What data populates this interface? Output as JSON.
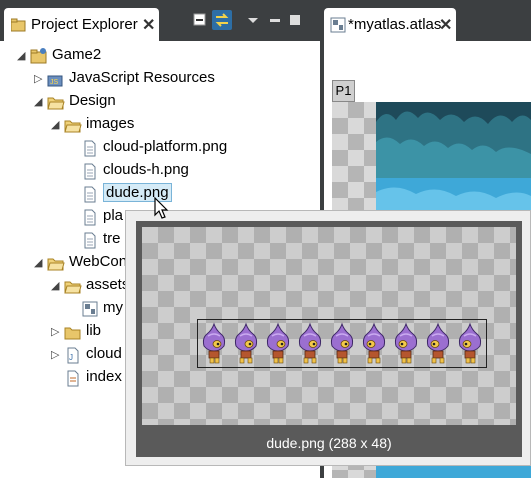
{
  "explorer": {
    "title": "Project Explorer",
    "tree": [
      {
        "label": "Game2",
        "icon": "project-folder-icon",
        "arrow": "expanded"
      },
      {
        "label": "JavaScript Resources",
        "icon": "js-resources-icon",
        "arrow": "collapsed"
      },
      {
        "label": "Design",
        "icon": "folder-open-icon",
        "arrow": "expanded"
      },
      {
        "label": "images",
        "icon": "folder-open-icon",
        "arrow": "expanded"
      },
      {
        "label": "cloud-platform.png",
        "icon": "file-icon",
        "arrow": ""
      },
      {
        "label": "clouds-h.png",
        "icon": "file-icon",
        "arrow": ""
      },
      {
        "label": "dude.png",
        "icon": "file-icon",
        "arrow": "",
        "selected": true
      },
      {
        "label": "pla",
        "icon": "file-icon",
        "arrow": ""
      },
      {
        "label": "tre",
        "icon": "file-icon",
        "arrow": ""
      },
      {
        "label": "WebCon",
        "icon": "folder-open-icon",
        "arrow": "expanded"
      },
      {
        "label": "assets",
        "icon": "folder-open-icon",
        "arrow": "expanded"
      },
      {
        "label": "my",
        "icon": "atlas-file-icon",
        "arrow": ""
      },
      {
        "label": "lib",
        "icon": "folder-closed-icon",
        "arrow": "collapsed"
      },
      {
        "label": "cloud",
        "icon": "js-file-icon",
        "arrow": "collapsed"
      },
      {
        "label": "index",
        "icon": "html-file-icon",
        "arrow": ""
      }
    ]
  },
  "editor": {
    "tab_title": "*myatlas.atlas",
    "page_tab": "P1"
  },
  "preview": {
    "caption": "dude.png (288 x 48)",
    "frame_count": 9
  },
  "colors": {
    "dark_chrome": "#3c3f41",
    "selection": "#d5ebf7",
    "active_tool": "#2d6ea5"
  }
}
